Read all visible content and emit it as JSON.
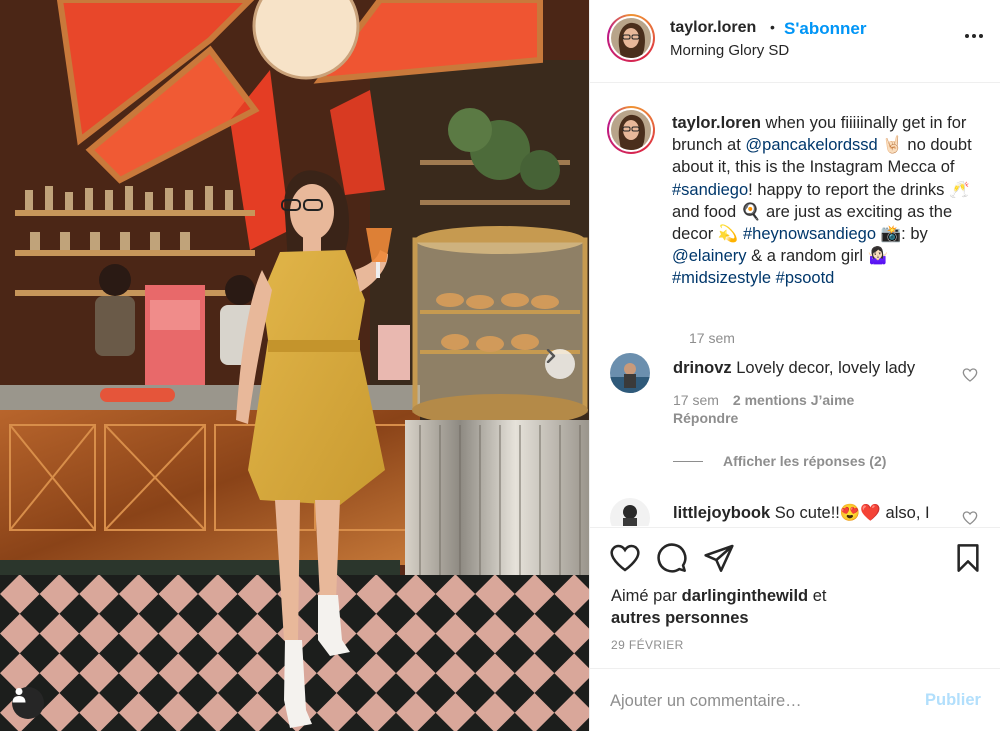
{
  "post": {
    "author": {
      "username": "taylor.loren",
      "separator": "•",
      "follow_label": "S'abonner",
      "location": "Morning Glory SD"
    },
    "caption": {
      "username": "taylor.loren",
      "segments": [
        {
          "text": " when you fiiiiinally get in for brunch at ",
          "link": false
        },
        {
          "text": "@pancakelordssd",
          "link": true
        },
        {
          "text": " 🤘🏻 no doubt about it, this is the Instagram Mecca of ",
          "link": false
        },
        {
          "text": "#sandiego",
          "link": true
        },
        {
          "text": "! happy to report the drinks 🥂 and food 🍳 are just as exciting as the decor 💫 ",
          "link": false
        },
        {
          "text": "#heynowsandiego",
          "link": true
        },
        {
          "text": " 📸: by ",
          "link": false
        },
        {
          "text": "@elainery",
          "link": true
        },
        {
          "text": " & a random girl 🤷🏻‍♀️ ",
          "link": false
        },
        {
          "text": "#midsizestyle",
          "link": true
        },
        {
          "text": " ",
          "link": false
        },
        {
          "text": "#psootd",
          "link": true
        }
      ],
      "time": "17 sem"
    },
    "comments": [
      {
        "username": "drinovz",
        "text": " Lovely decor, lovely lady",
        "time": "17 sem",
        "likes": "2 mentions J’aime",
        "reply": "Répondre",
        "view_replies": "Afficher les réponses (2)"
      },
      {
        "username": "littlejoybook",
        "text": " So cute!!😍❤️ also, I"
      }
    ],
    "liked_by": {
      "prefix": "Aimé par ",
      "user": "darlinginthewild",
      "middle": " et",
      "others": "autres personnes"
    },
    "date": "29 FÉVRIER",
    "add_comment": {
      "placeholder": "Ajouter un commentaire…",
      "publish_label": "Publier"
    },
    "icons": {
      "like": "heart-icon",
      "comment": "comment-icon",
      "share": "share-icon",
      "save": "bookmark-icon",
      "more": "more-icon",
      "user_tags": "user-tag-icon",
      "next": "chevron-right-icon"
    },
    "colors": {
      "accent": "#0095f6",
      "link": "#00376b",
      "muted": "#8e8e8e",
      "publish_disabled": "#b2dffc",
      "text": "#262626"
    }
  }
}
